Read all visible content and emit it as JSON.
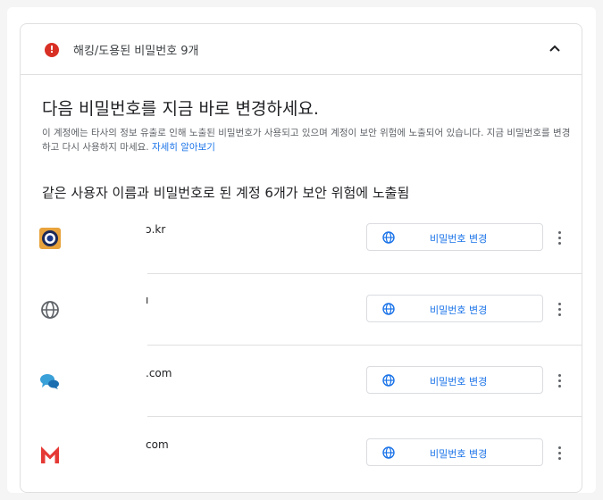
{
  "header": {
    "title": "해킹/도용된 비밀번호 9개",
    "alert_glyph": "!"
  },
  "headline": "다음 비밀번호를 지금 바로 변경하세요.",
  "description": {
    "text": "이 계정에는 타사의 정보 유출로 인해 노출된 비밀번호가 사용되고 있으며 계정이 보안 위험에 노출되어 있습니다. 지금 비밀번호를 변경하고 다시 사용하지 마세요. ",
    "link": "자세히 알아보기"
  },
  "subheading": "같은 사용자 이름과 비밀번호로 된 계정 6개가 보안 위험에 노출됨",
  "accounts": [
    {
      "site_text": "ɔ.kr",
      "icon": "eye-logo-icon",
      "button_label": "비밀번호 변경"
    },
    {
      "site_text": "ı",
      "icon": "globe-icon",
      "button_label": "비밀번호 변경"
    },
    {
      "site_text": ".com",
      "icon": "chat-bubbles-icon",
      "button_label": "비밀번호 변경"
    },
    {
      "site_text": "com",
      "icon": "gmail-m-icon",
      "button_label": "비밀번호 변경"
    }
  ],
  "colors": {
    "accent": "#1a73e8",
    "alert": "#d93025",
    "divider": "#e0e0e0"
  }
}
